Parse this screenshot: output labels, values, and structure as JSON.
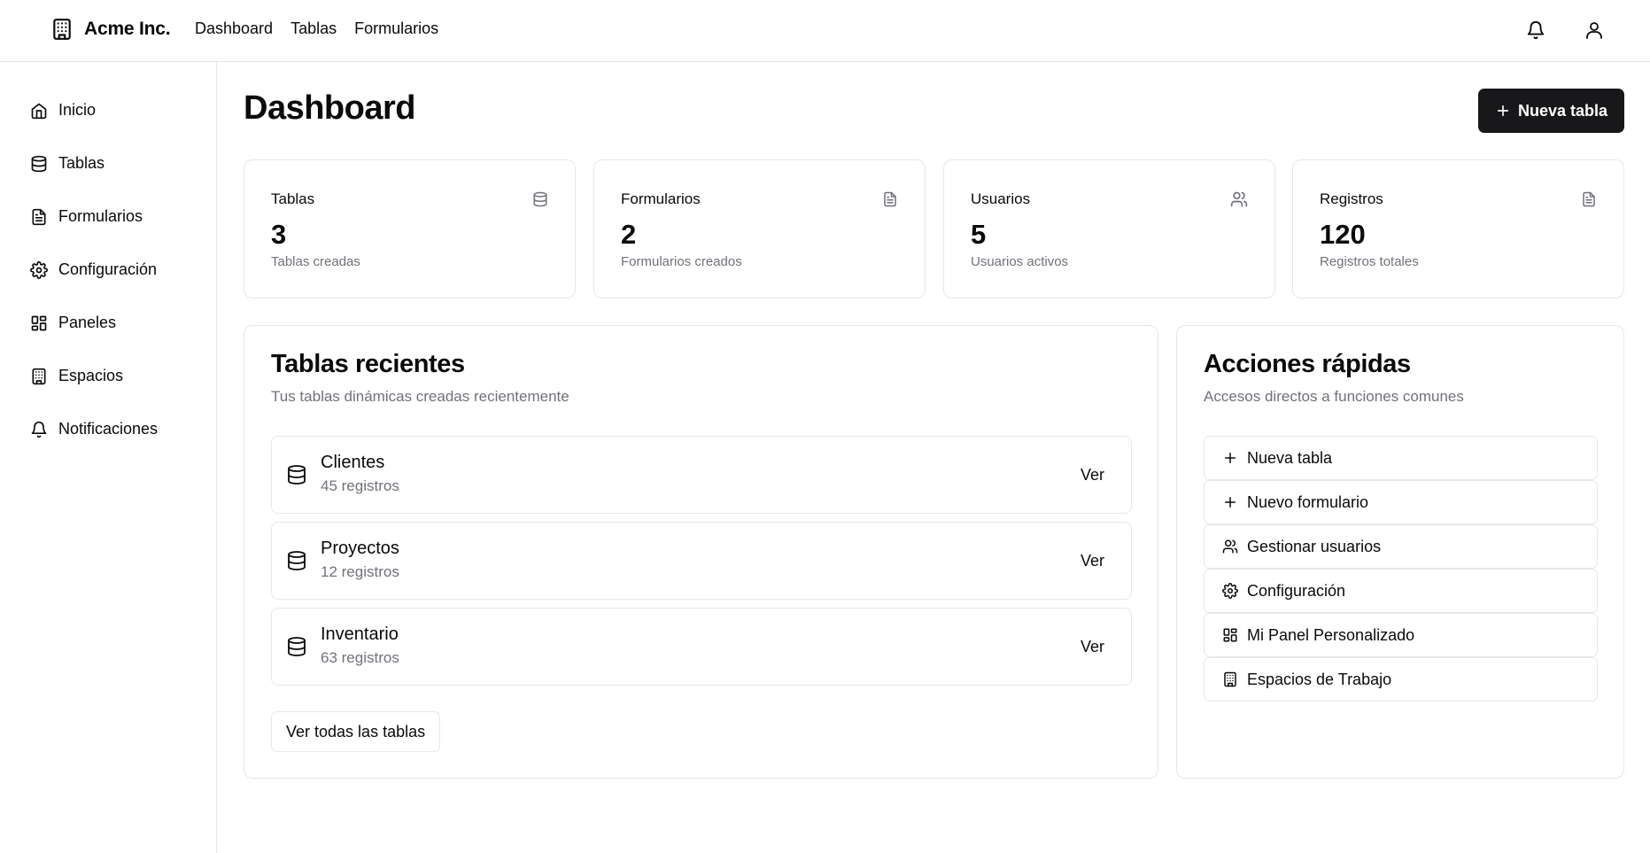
{
  "app": {
    "brand": "Acme Inc."
  },
  "topnav": {
    "items": [
      {
        "label": "Dashboard"
      },
      {
        "label": "Tablas"
      },
      {
        "label": "Formularios"
      }
    ]
  },
  "sidebar": {
    "items": [
      {
        "label": "Inicio",
        "icon": "home-icon"
      },
      {
        "label": "Tablas",
        "icon": "database-icon"
      },
      {
        "label": "Formularios",
        "icon": "file-text-icon"
      },
      {
        "label": "Configuración",
        "icon": "gear-icon"
      },
      {
        "label": "Paneles",
        "icon": "layout-dashboard-icon"
      },
      {
        "label": "Espacios",
        "icon": "building-icon"
      },
      {
        "label": "Notificaciones",
        "icon": "bell-icon"
      }
    ]
  },
  "main": {
    "title": "Dashboard",
    "new_table_button": "Nueva tabla",
    "stats": [
      {
        "label": "Tablas",
        "value": "3",
        "sub": "Tablas creadas",
        "icon": "database-icon"
      },
      {
        "label": "Formularios",
        "value": "2",
        "sub": "Formularios creados",
        "icon": "file-text-icon"
      },
      {
        "label": "Usuarios",
        "value": "5",
        "sub": "Usuarios activos",
        "icon": "users-icon"
      },
      {
        "label": "Registros",
        "value": "120",
        "sub": "Registros totales",
        "icon": "file-text-icon"
      }
    ],
    "recent": {
      "title": "Tablas recientes",
      "subtitle": "Tus tablas dinámicas creadas recientemente",
      "rows": [
        {
          "name": "Clientes",
          "count": "45 registros",
          "action": "Ver"
        },
        {
          "name": "Proyectos",
          "count": "12 registros",
          "action": "Ver"
        },
        {
          "name": "Inventario",
          "count": "63 registros",
          "action": "Ver"
        }
      ],
      "view_all": "Ver todas las tablas"
    },
    "quick": {
      "title": "Acciones rápidas",
      "subtitle": "Accesos directos a funciones comunes",
      "items": [
        {
          "label": "Nueva tabla",
          "icon": "plus-icon"
        },
        {
          "label": "Nuevo formulario",
          "icon": "plus-icon"
        },
        {
          "label": "Gestionar usuarios",
          "icon": "users-icon"
        },
        {
          "label": "Configuración",
          "icon": "gear-icon"
        },
        {
          "label": "Mi Panel Personalizado",
          "icon": "layout-dashboard-icon"
        },
        {
          "label": "Espacios de Trabajo",
          "icon": "building-icon"
        }
      ]
    }
  }
}
